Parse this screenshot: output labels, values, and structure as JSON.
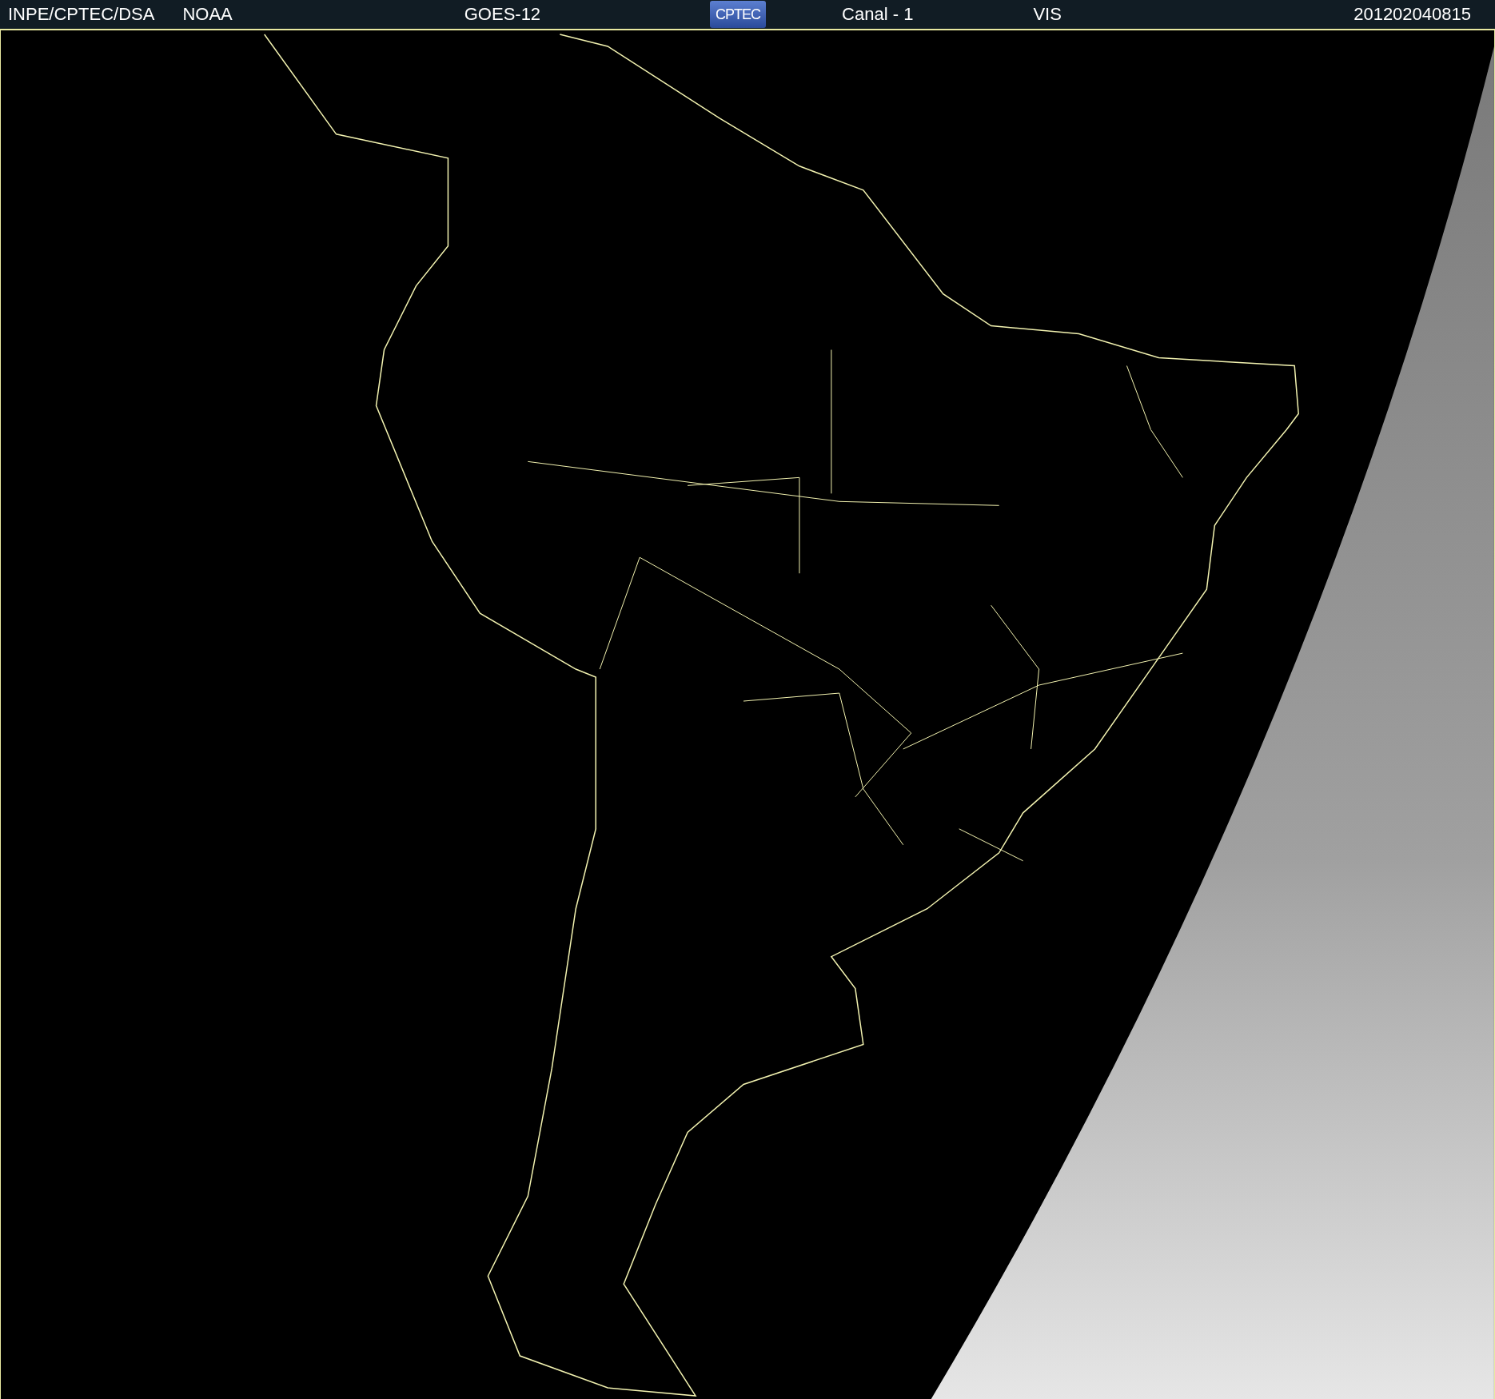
{
  "header": {
    "source": "INPE/CPTEC/DSA",
    "agency": "NOAA",
    "satellite": "GOES-12",
    "logo_text": "CPTEC",
    "channel": "Canal - 1",
    "band": "VIS",
    "timestamp": "201202040815"
  }
}
